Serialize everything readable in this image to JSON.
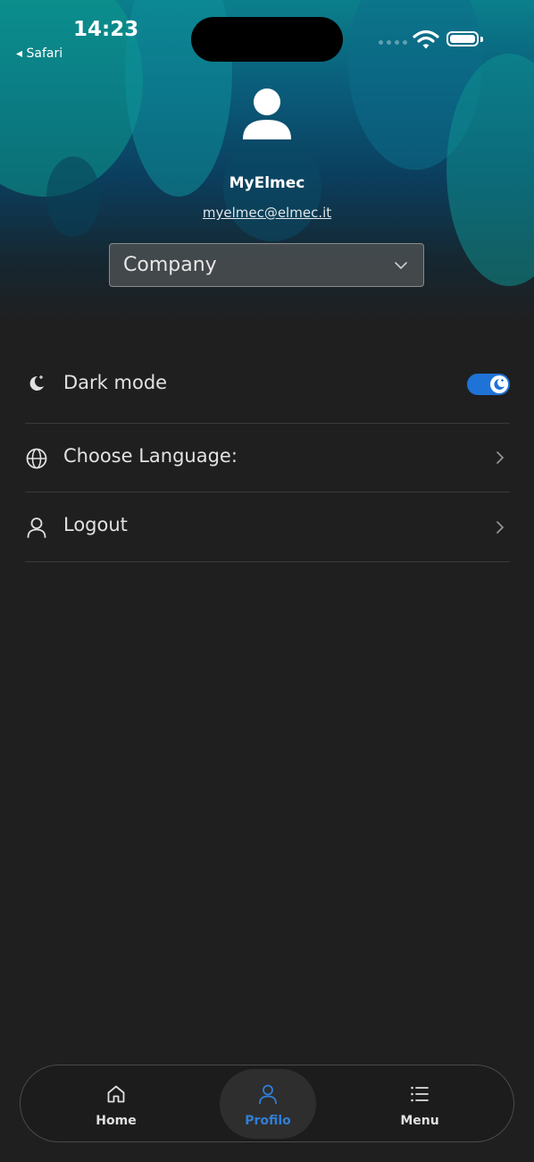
{
  "status_bar": {
    "time": "14:23",
    "back_app": "◂ Safari",
    "back_arrow_icon": "back-triangle-icon",
    "wifi_icon": "wifi-icon",
    "battery_icon": "battery-icon"
  },
  "profile": {
    "avatar_icon": "user-avatar-icon",
    "name": "MyElmec",
    "email": "myelmec@elmec.it"
  },
  "company_select": {
    "selected": "Company",
    "icon": "chevron-down-icon"
  },
  "settings": {
    "dark_mode": {
      "label": "Dark mode",
      "icon": "moon-icon",
      "enabled": true
    },
    "language": {
      "label": "Choose Language:",
      "icon": "globe-icon"
    },
    "logout": {
      "label": "Logout",
      "icon": "user-icon"
    }
  },
  "bottom_nav": {
    "items": [
      {
        "label": "Home",
        "icon": "home-icon",
        "active": false
      },
      {
        "label": "Profilo",
        "icon": "user-icon",
        "active": true
      },
      {
        "label": "Menu",
        "icon": "list-icon",
        "active": false
      }
    ]
  },
  "colors": {
    "background": "#1f1f1f",
    "accent": "#1f73d6",
    "active_nav": "#2f7fd8",
    "header_teal": "#0b7f8c"
  }
}
